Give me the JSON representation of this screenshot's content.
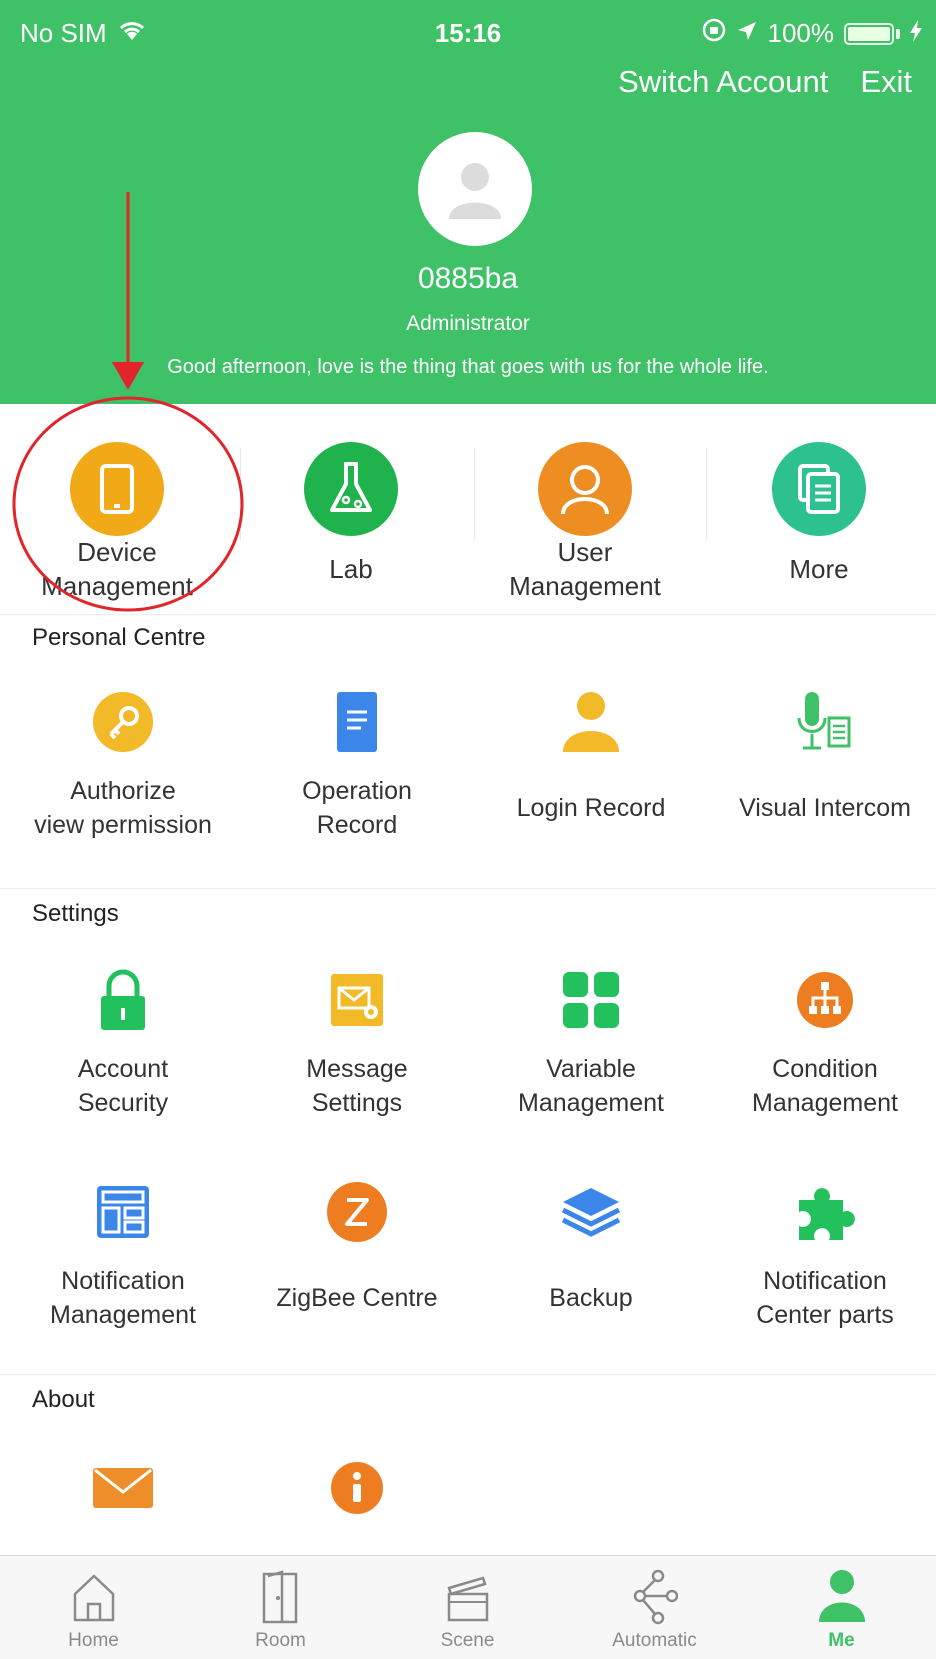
{
  "status_bar": {
    "carrier": "No SIM",
    "time": "15:16",
    "battery": "100%"
  },
  "header": {
    "switch_account": "Switch Account",
    "exit": "Exit",
    "username": "0885ba",
    "role": "Administrator",
    "greeting": "Good afternoon, love is the thing that goes with us for the whole life."
  },
  "quick": [
    {
      "label": "Device\nManagement",
      "color": "#f2a917",
      "icon": "phone-icon"
    },
    {
      "label": "Lab",
      "color": "#1fb24d",
      "icon": "flask-icon"
    },
    {
      "label": "User\nManagement",
      "color": "#ee8e22",
      "icon": "user-icon"
    },
    {
      "label": "More",
      "color": "#2ec190",
      "icon": "documents-icon"
    }
  ],
  "personal": {
    "title": "Personal Centre",
    "items": [
      {
        "label": "Authorize\nview permission",
        "icon": "key-icon",
        "color": "#f2b928"
      },
      {
        "label": "Operation\nRecord",
        "icon": "document-icon",
        "color": "#3b86e8"
      },
      {
        "label": "Login Record",
        "icon": "person-icon",
        "color": "#f2b928"
      },
      {
        "label": "Visual Intercom",
        "icon": "microphone-icon",
        "color": "#3fc168"
      }
    ]
  },
  "settings": {
    "title": "Settings",
    "items": [
      {
        "label": "Account\nSecurity",
        "icon": "lock-icon",
        "color": "#22c15e"
      },
      {
        "label": "Message\nSettings",
        "icon": "mail-settings-icon",
        "color": "#f2b928"
      },
      {
        "label": "Variable\nManagement",
        "icon": "grid-icon",
        "color": "#22c15e"
      },
      {
        "label": "Condition\nManagement",
        "icon": "hierarchy-icon",
        "color": "#ee7d22"
      },
      {
        "label": "Notification\nManagement",
        "icon": "layout-icon",
        "color": "#3b86e8"
      },
      {
        "label": "ZigBee Centre",
        "icon": "zigbee-icon",
        "color": "#ee7d22"
      },
      {
        "label": "Backup",
        "icon": "layers-icon",
        "color": "#3b86e8"
      },
      {
        "label": "Notification\nCenter parts",
        "icon": "puzzle-icon",
        "color": "#22c15e"
      }
    ]
  },
  "about": {
    "title": "About",
    "items": [
      {
        "icon": "envelope-icon",
        "color": "#ee8e2a"
      },
      {
        "icon": "info-icon",
        "color": "#ee7d22"
      }
    ]
  },
  "tabs": [
    {
      "label": "Home",
      "icon": "home-icon"
    },
    {
      "label": "Room",
      "icon": "door-icon"
    },
    {
      "label": "Scene",
      "icon": "clapperboard-icon"
    },
    {
      "label": "Automatic",
      "icon": "nodes-icon"
    },
    {
      "label": "Me",
      "icon": "me-icon",
      "active": true
    }
  ],
  "colors": {
    "brand": "#3fc168",
    "annotation": "#e0262a"
  }
}
